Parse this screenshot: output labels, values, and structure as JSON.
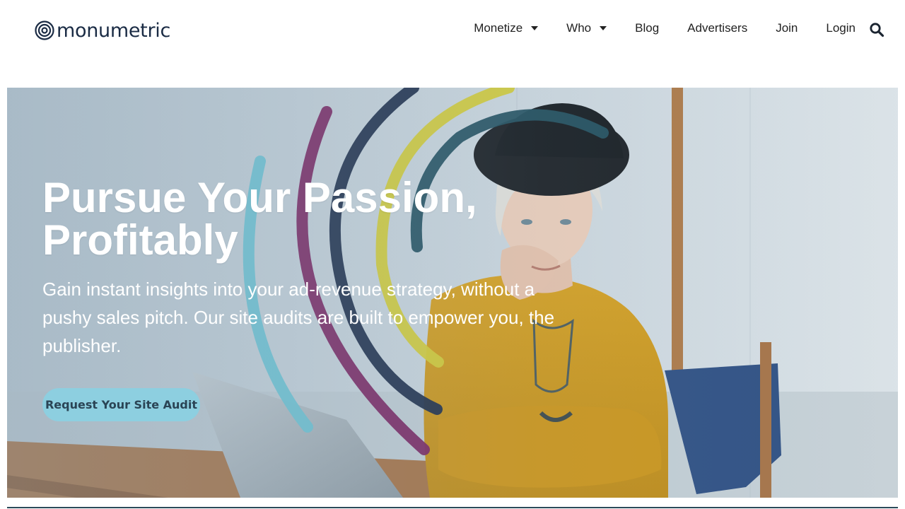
{
  "brand": {
    "name": "monumetric",
    "color": "#1a2b44"
  },
  "nav": {
    "items": [
      {
        "label": "Monetize",
        "dropdown": true
      },
      {
        "label": "Who",
        "dropdown": true
      },
      {
        "label": "Blog",
        "dropdown": false
      },
      {
        "label": "Advertisers",
        "dropdown": false
      },
      {
        "label": "Join",
        "dropdown": false
      },
      {
        "label": "Login",
        "dropdown": false
      }
    ],
    "search_icon": "search-icon"
  },
  "hero": {
    "title": "Pursue Your Passion, Profitably",
    "subtitle": "Gain instant insights into your ad-revenue strategy, without a pushy sales pitch. Our site audits are built to empower you, the publisher.",
    "cta_label": "Request Your Site Audit",
    "cta_color": "#8dcfe0",
    "arc_colors": [
      "#6cc3d3",
      "#7a2360",
      "#1b2b48",
      "#d4cc36",
      "#22505f"
    ]
  }
}
